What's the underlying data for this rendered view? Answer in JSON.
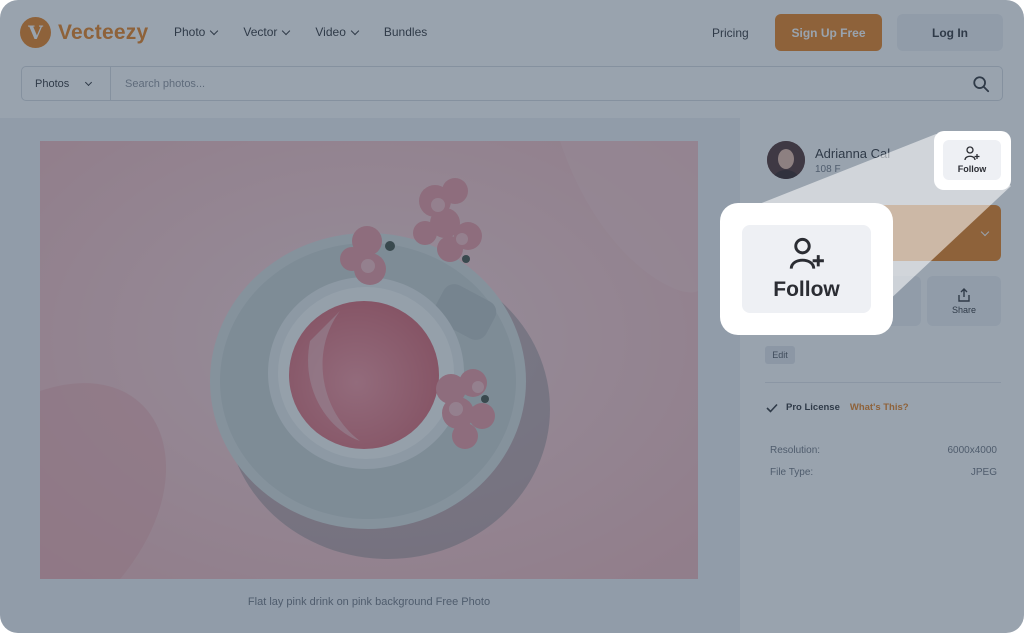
{
  "header": {
    "logo_text": "Vecteezy",
    "logo_letter": "V",
    "nav": [
      {
        "label": "Photo",
        "has_dropdown": true
      },
      {
        "label": "Vector",
        "has_dropdown": true
      },
      {
        "label": "Video",
        "has_dropdown": true
      },
      {
        "label": "Bundles",
        "has_dropdown": false
      }
    ],
    "pricing_label": "Pricing",
    "signup_label": "Sign Up Free",
    "login_label": "Log In"
  },
  "search": {
    "type_label": "Photos",
    "placeholder": "Search photos..."
  },
  "photo": {
    "caption": "Flat lay pink drink on pink background Free Photo"
  },
  "author": {
    "name": "Adrianna Cal",
    "followers": "108 F",
    "follow_label": "Follow"
  },
  "actions": {
    "share_label": "Share",
    "edit_label": "Edit"
  },
  "license": {
    "label": "Pro License",
    "link": "What's This?"
  },
  "details": [
    {
      "label": "Resolution:",
      "value": "6000x4000"
    },
    {
      "label": "File Type:",
      "value": "JPEG"
    }
  ],
  "callout": {
    "follow_label": "Follow"
  },
  "colors": {
    "accent": "#e87d17",
    "overlay": "#34485e"
  }
}
